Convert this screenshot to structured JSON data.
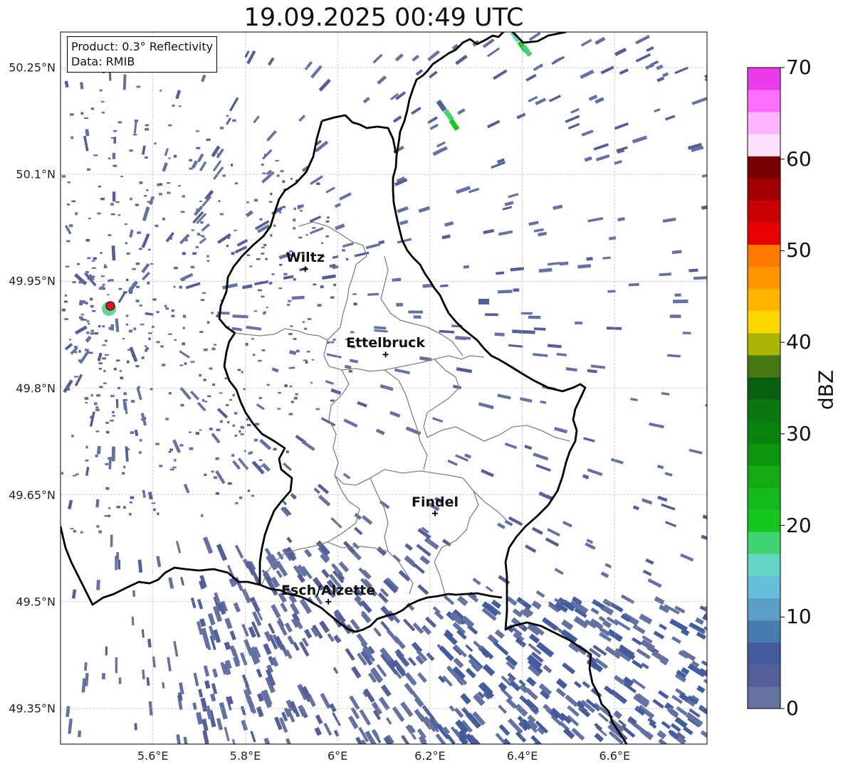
{
  "title": "19.09.2025 00:49 UTC",
  "info_box": {
    "product": "Product: 0.3° Reflectivity",
    "data": "Data: RMIB"
  },
  "map": {
    "lon_range": [
      5.4,
      6.8
    ],
    "lat_range": [
      49.3,
      50.3
    ],
    "lat_ticks": [
      {
        "value": 50.25,
        "label": "50.25°N"
      },
      {
        "value": 50.1,
        "label": "50.1°N"
      },
      {
        "value": 49.95,
        "label": "49.95°N"
      },
      {
        "value": 49.8,
        "label": "49.8°N"
      },
      {
        "value": 49.65,
        "label": "49.65°N"
      },
      {
        "value": 49.5,
        "label": "49.5°N"
      },
      {
        "value": 49.35,
        "label": "49.35°N"
      }
    ],
    "lon_ticks": [
      {
        "value": 5.6,
        "label": "5.6°E"
      },
      {
        "value": 5.8,
        "label": "5.8°E"
      },
      {
        "value": 6.0,
        "label": "6°E"
      },
      {
        "value": 6.2,
        "label": "6.2°E"
      },
      {
        "value": 6.4,
        "label": "6.4°E"
      },
      {
        "value": 6.6,
        "label": "6.6°E"
      }
    ],
    "grid": true,
    "cities": [
      {
        "name": "Wiltz",
        "lon": 5.93,
        "lat": 49.967
      },
      {
        "name": "Ettelbruck",
        "lon": 6.104,
        "lat": 49.847
      },
      {
        "name": "Findel",
        "lon": 6.211,
        "lat": 49.624
      },
      {
        "name": "Esch/Alzette",
        "lon": 5.98,
        "lat": 49.5
      }
    ],
    "radar_site": {
      "lon": 5.505,
      "lat": 49.914
    },
    "colors": {
      "country_border": "#000000",
      "canton_border": "#808080",
      "radar_site": "#e8141b"
    }
  },
  "colorbar": {
    "unit": "dBZ",
    "min": 0,
    "max": 70,
    "ticks": [
      {
        "value": 0,
        "label": "0"
      },
      {
        "value": 10,
        "label": "10"
      },
      {
        "value": 20,
        "label": "20"
      },
      {
        "value": 30,
        "label": "30"
      },
      {
        "value": 40,
        "label": "40"
      },
      {
        "value": 50,
        "label": "50"
      },
      {
        "value": 60,
        "label": "60"
      },
      {
        "value": 70,
        "label": "70"
      }
    ],
    "colors": [
      "#6472a3",
      "#525f99",
      "#435c9e",
      "#4a7bb0",
      "#5c9fc6",
      "#64c0d8",
      "#66d6c4",
      "#40d470",
      "#14c81e",
      "#14b91e",
      "#14aa14",
      "#0f960f",
      "#0a820f",
      "#0a780f",
      "#0a5f0f",
      "#467814",
      "#aab405",
      "#ffd700",
      "#ffb400",
      "#ff9600",
      "#ff7800",
      "#e60000",
      "#c80000",
      "#a00000",
      "#780000",
      "#ffe1ff",
      "#ffb4ff",
      "#ff6eff",
      "#eb3ceb"
    ]
  }
}
